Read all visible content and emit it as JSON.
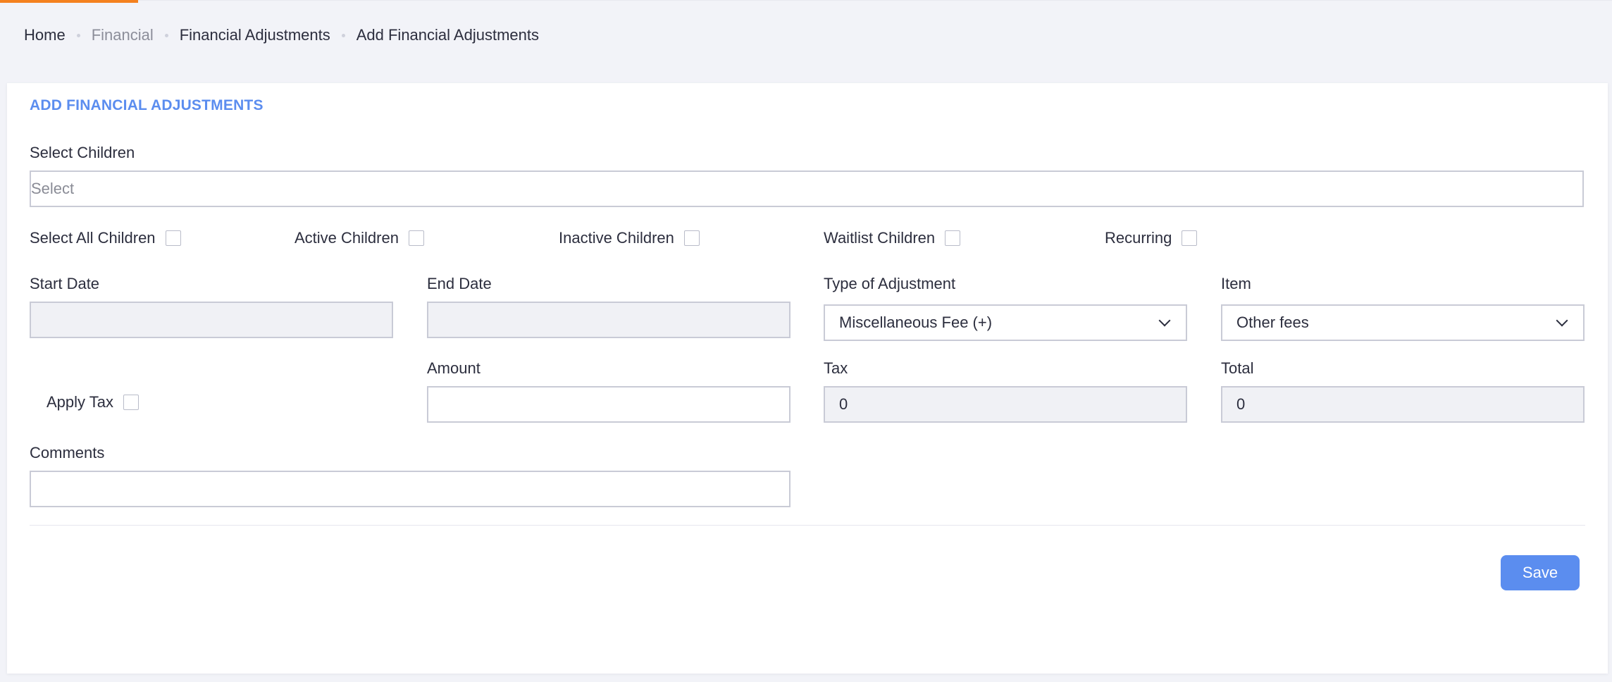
{
  "breadcrumb": {
    "home": "Home",
    "financial": "Financial",
    "financial_adjustments": "Financial Adjustments",
    "current": "Add Financial Adjustments"
  },
  "form": {
    "title": "ADD FINANCIAL ADJUSTMENTS",
    "select_children": {
      "label": "Select Children",
      "placeholder": "Select"
    },
    "checkboxes": {
      "select_all": "Select All Children",
      "active": "Active Children",
      "inactive": "Inactive Children",
      "waitlist": "Waitlist Children",
      "recurring": "Recurring"
    },
    "start_date": {
      "label": "Start Date",
      "value": ""
    },
    "end_date": {
      "label": "End Date",
      "value": ""
    },
    "type_of_adjustment": {
      "label": "Type of Adjustment",
      "value": "Miscellaneous Fee (+)"
    },
    "item": {
      "label": "Item",
      "value": "Other fees"
    },
    "apply_tax": {
      "label": "Apply Tax"
    },
    "amount": {
      "label": "Amount",
      "value": ""
    },
    "tax": {
      "label": "Tax",
      "value": "0"
    },
    "total": {
      "label": "Total",
      "value": "0"
    },
    "comments": {
      "label": "Comments",
      "value": ""
    },
    "save_label": "Save"
  },
  "colors": {
    "accent": "#5b8def",
    "top_accent": "#f4811f"
  }
}
